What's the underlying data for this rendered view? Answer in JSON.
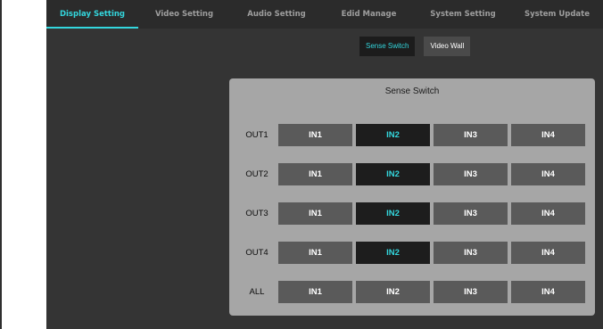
{
  "tabs": [
    "Display Setting",
    "Video Setting",
    "Audio Setting",
    "Edid Manage",
    "System Setting",
    "System Update"
  ],
  "active_tab": "Display Setting",
  "subtabs": [
    "Sense Switch",
    "Video Wall"
  ],
  "active_subtab": "Sense Switch",
  "panel": {
    "title": "Sense Switch",
    "rows": [
      {
        "label": "OUT1",
        "inputs": [
          "IN1",
          "IN2",
          "IN3",
          "IN4"
        ],
        "selected": "IN2"
      },
      {
        "label": "OUT2",
        "inputs": [
          "IN1",
          "IN2",
          "IN3",
          "IN4"
        ],
        "selected": "IN2"
      },
      {
        "label": "OUT3",
        "inputs": [
          "IN1",
          "IN2",
          "IN3",
          "IN4"
        ],
        "selected": "IN2"
      },
      {
        "label": "OUT4",
        "inputs": [
          "IN1",
          "IN2",
          "IN3",
          "IN4"
        ],
        "selected": "IN2"
      },
      {
        "label": "ALL",
        "inputs": [
          "IN1",
          "IN2",
          "IN3",
          "IN4"
        ],
        "selected": null
      }
    ]
  },
  "colors": {
    "accent": "#33d6dd",
    "background": "#343434",
    "topbar": "#2b2b2b",
    "panel": "#a6a6a6",
    "button": "#5a5a5a",
    "button_selected": "#1d1d1d"
  }
}
